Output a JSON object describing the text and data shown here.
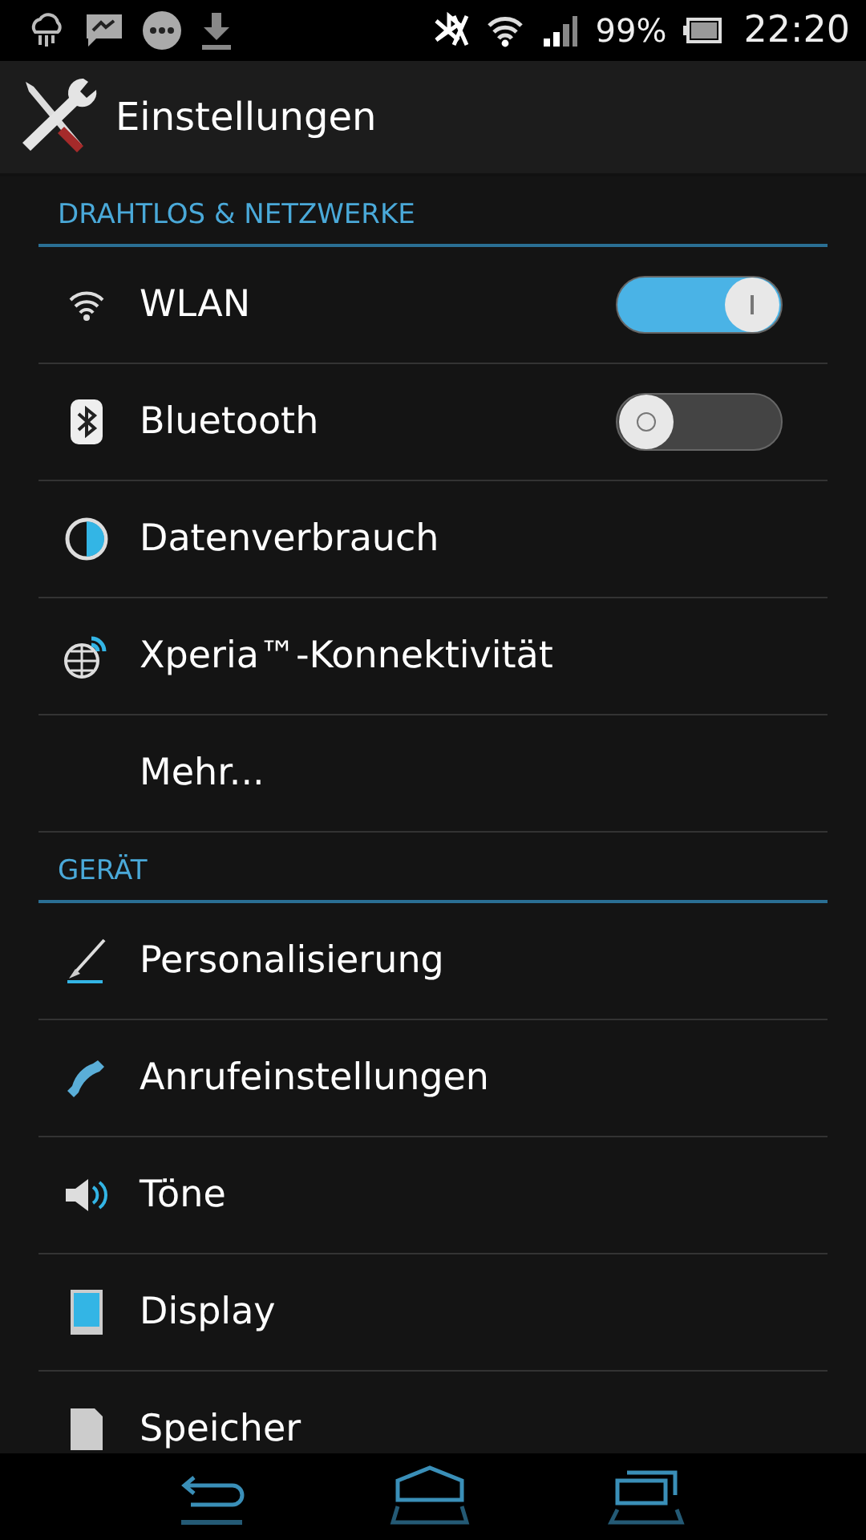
{
  "status_bar": {
    "battery": "99%",
    "time": "22:20"
  },
  "action_bar": {
    "title": "Einstellungen"
  },
  "sections": [
    {
      "header": "DRAHTLOS & NETZWERKE",
      "items": [
        {
          "label": "WLAN",
          "kind": "toggle",
          "on": true
        },
        {
          "label": "Bluetooth",
          "kind": "toggle",
          "on": false
        },
        {
          "label": "Datenverbrauch",
          "kind": "plain"
        },
        {
          "label": "Xperia™-Konnektivität",
          "kind": "plain"
        },
        {
          "label": "Mehr...",
          "kind": "plain"
        }
      ]
    },
    {
      "header": "GERÄT",
      "items": [
        {
          "label": "Personalisierung",
          "kind": "plain"
        },
        {
          "label": "Anrufeinstellungen",
          "kind": "plain"
        },
        {
          "label": "Töne",
          "kind": "plain"
        },
        {
          "label": "Display",
          "kind": "plain"
        },
        {
          "label": "Speicher",
          "kind": "plain"
        }
      ]
    }
  ]
}
